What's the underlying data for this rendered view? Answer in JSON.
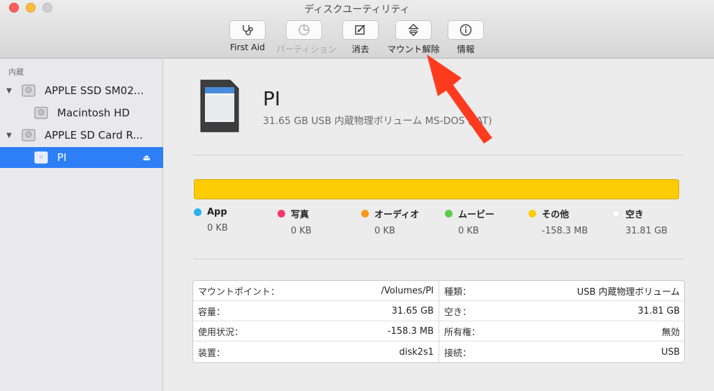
{
  "window": {
    "title": "ディスクユーティリティ"
  },
  "toolbar": {
    "first_aid": "First Aid",
    "partition": "パーティション",
    "erase": "消去",
    "unmount": "マウント解除",
    "info": "情報"
  },
  "sidebar": {
    "header": "内蔵",
    "items": [
      {
        "label": "APPLE SSD SM02..."
      },
      {
        "label": "Macintosh HD"
      },
      {
        "label": "APPLE SD Card R..."
      },
      {
        "label": "PI"
      }
    ]
  },
  "volume": {
    "name": "PI",
    "description": "31.65 GB USB 内蔵物理ボリューム MS-DOS (FAT)"
  },
  "usage": {
    "bar_color": "#fdcc02",
    "categories": [
      {
        "label": "App",
        "value": "0 KB",
        "color": "#2bb0ef"
      },
      {
        "label": "写真",
        "value": "0 KB",
        "color": "#f4356e"
      },
      {
        "label": "オーディオ",
        "value": "0 KB",
        "color": "#f79a1b"
      },
      {
        "label": "ムービー",
        "value": "0 KB",
        "color": "#5ccb4c"
      },
      {
        "label": "その他",
        "value": "-158.3 MB",
        "color": "#fdcc02"
      },
      {
        "label": "空き",
        "value": "31.81 GB",
        "color": "#ffffff"
      }
    ]
  },
  "info": {
    "left": [
      {
        "key": "マウントポイント：",
        "value": "/Volumes/PI"
      },
      {
        "key": "容量：",
        "value": "31.65 GB"
      },
      {
        "key": "使用状況：",
        "value": "-158.3 MB"
      },
      {
        "key": "装置：",
        "value": "disk2s1"
      }
    ],
    "right": [
      {
        "key": "種類：",
        "value": "USB 内蔵物理ボリューム"
      },
      {
        "key": "空き：",
        "value": "31.81 GB"
      },
      {
        "key": "所有権：",
        "value": "無効"
      },
      {
        "key": "接続：",
        "value": "USB"
      }
    ]
  },
  "annotation": {
    "arrow_color": "#ff3b1f"
  }
}
